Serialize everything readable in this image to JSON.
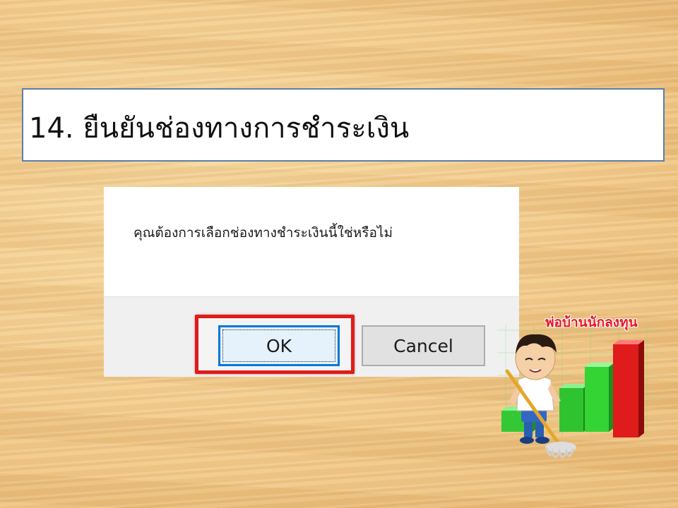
{
  "slide": {
    "title": "14. ยืนยันช่องทางการชำระเงิน"
  },
  "dialog": {
    "message": "คุณต้องการเลือกช่องทางชำระเงินนี้ใช่หรือไม่",
    "ok_label": "OK",
    "cancel_label": "Cancel",
    "highlighted_button": "OK",
    "highlight_color": "#e01b1b",
    "focus_color": "#0078d7"
  },
  "brand": {
    "name": "พ่อบ้านนักลงทุน",
    "name_color": "#e5172b",
    "bar_colors": [
      "#2ecc2e",
      "#26b526",
      "#e01b1b"
    ]
  }
}
